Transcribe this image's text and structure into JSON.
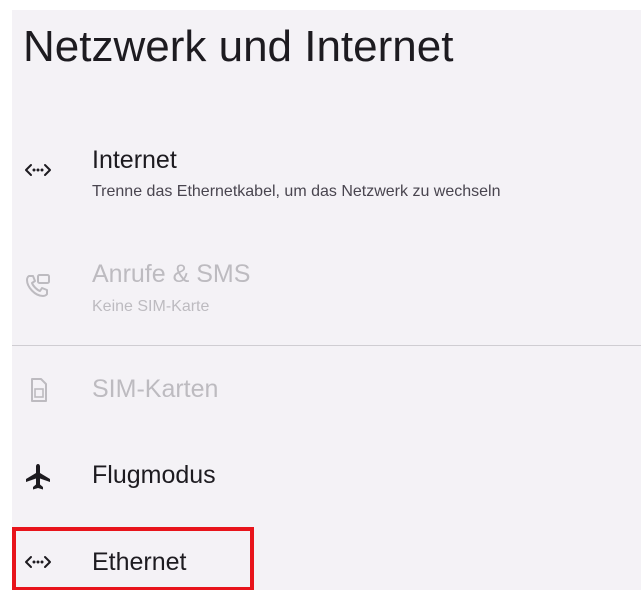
{
  "header": {
    "title": "Netzwerk und Internet"
  },
  "settings": {
    "items": [
      {
        "label": "Internet",
        "summary": "Trenne das Ethernetkabel, um das Netzwerk zu wechseln",
        "icon": "ethernet-icon",
        "enabled": true
      },
      {
        "label": "Anrufe & SMS",
        "summary": "Keine SIM-Karte",
        "icon": "calls-sms-icon",
        "enabled": false
      },
      {
        "label": "SIM-Karten",
        "icon": "sim-card-icon",
        "enabled": false
      },
      {
        "label": "Flugmodus",
        "icon": "airplane-icon",
        "enabled": true
      },
      {
        "label": "Ethernet",
        "icon": "ethernet-icon",
        "enabled": true,
        "highlighted": true
      }
    ]
  },
  "colors": {
    "background": "#f4f2f6",
    "text_primary": "#1d1b20",
    "text_secondary": "#49454f",
    "text_disabled": "#bdbbc0",
    "highlight": "#e8141b"
  }
}
